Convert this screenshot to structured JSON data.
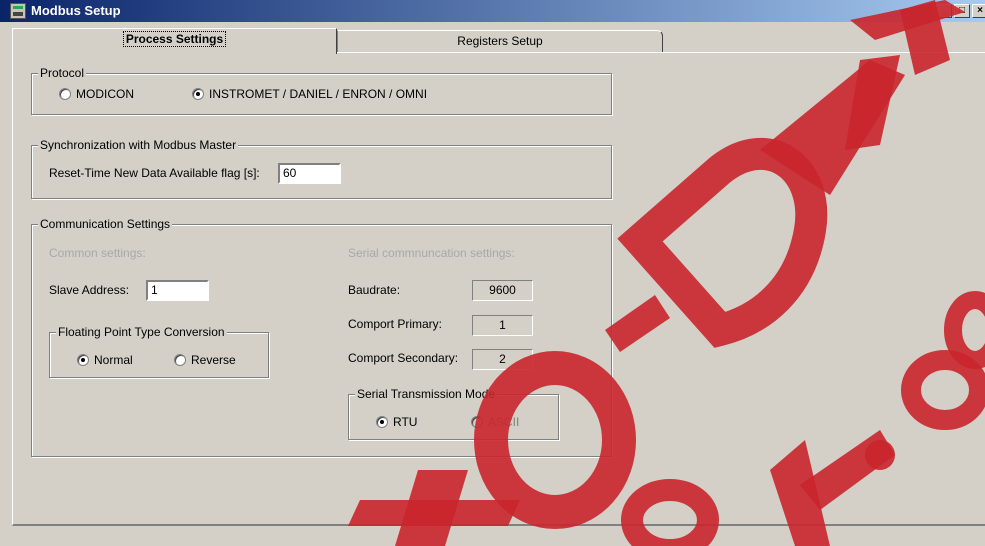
{
  "window": {
    "title": "Modbus Setup",
    "controls": [
      "_",
      "□",
      "×"
    ]
  },
  "tabs": [
    {
      "label": "Process Settings",
      "active": true
    },
    {
      "label": "Registers Setup",
      "active": false
    }
  ],
  "protocol": {
    "title": "Protocol",
    "options": [
      {
        "label": "MODICON",
        "checked": false
      },
      {
        "label": "INSTROMET / DANIEL / ENRON / OMNI",
        "checked": true
      }
    ]
  },
  "sync": {
    "title": "Synchronization with Modbus Master",
    "reset_label": "Reset-Time New Data Available flag [s]:",
    "reset_value": "60"
  },
  "comm": {
    "title": "Communication Settings",
    "common_title": "Common settings:",
    "serial_title": "Serial commnuncation settings:",
    "slave_label": "Slave Address:",
    "slave_value": "1",
    "fp": {
      "title": "Floating Point Type Conversion",
      "normal": "Normal",
      "reverse": "Reverse",
      "selected": "Normal"
    },
    "baud_label": "Baudrate:",
    "baud_value": "9600",
    "comp1_label": "Comport Primary:",
    "comp1_value": "1",
    "comp2_label": "Comport Secondary:",
    "comp2_value": "2",
    "stm": {
      "title": "Serial Transmission Mode",
      "rtu": "RTU",
      "ascii": "ASCII",
      "selected": "RTU"
    }
  },
  "watermark": {
    "text": "TO-DATA ek.co",
    "color": "#c9252c"
  }
}
